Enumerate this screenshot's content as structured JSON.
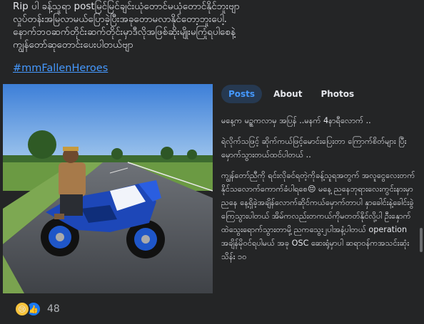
{
  "caption": {
    "lines": [
      "Rip ပါ ခန့်သူရာ postမြင်မြင်ချင်းယုံတောင်မယုံတောင်နိုင်ဘူးဗျာ",
      "လှုပ်တန်းအမြလာမယ်ပြောခဲ့ပြီးအခုတောမလာနိုင်တော့ဘူးပေါ့.",
      "နောက်ဘဝဆက်တိုင်းဆက်တိုင်းမှာဒီလိုအဖြစ်ဆိုးမျိုးမကြုံရပါစေနဲ့",
      "ကျွန်တော်ဆုတောင်းပေးပါတယ်ဗျာ"
    ],
    "hashtag": "#mmFallenHeroes"
  },
  "tabs": [
    {
      "label": "Posts",
      "active": true
    },
    {
      "label": "About",
      "active": false
    },
    {
      "label": "Photos",
      "active": false
    }
  ],
  "post": {
    "paragraphs": [
      "မနေ့က မဥ္စကလာမှ အပြန် ..မနက် 4နာရီလောက် ..",
      "ရဲလိုက်သဖြင့် ဆိုက်ကယ်ဖြင့်မောင်းပြေးတာ ကြောက်စိတ်များ ပြီးမှောက်သွားတယ်ထင်ပါတယ် ..",
      "ကျွန်တော်ညီကို ရင်းလိုခင်ရတဲ့ကိုခန့်သူရအတွက် အလူငွေလေးတက်နိုင်သလောက်ကောက်ခံပါရစေ😔 မနေ့ ညနေဘုရားလေးကွင်းနားမှာညနေ နေ့ရှိခဲ့အချိန်လောက်ဆိုင်ကယ်မှောက်တာပါ နှာခေါင်းနဲ့ခေါင်းခွဲကြေသွားပါတယ် အိမ်ကလည်းတကယ်ကိုမတတ်နိုင်လို့ပါ ဦးနှောက်ထဲသွေးရောက်သွားတာမို့ ညကသွေး၂ပါအနံ့ပါတယ် operation အချိန်မိုဝင်ရပါမယ် အခု OSC ဆေးရုံမှာပါ ဆရာဝန်ကအသင်းဆုံးသိန်း ၁၀"
    ]
  },
  "reactions": {
    "icons": [
      "sad-icon",
      "like-icon"
    ],
    "count": "48"
  },
  "colors": {
    "background": "#242526",
    "accent": "#4599ff",
    "text": "#e4e6eb",
    "muted": "#b0b3b8"
  }
}
